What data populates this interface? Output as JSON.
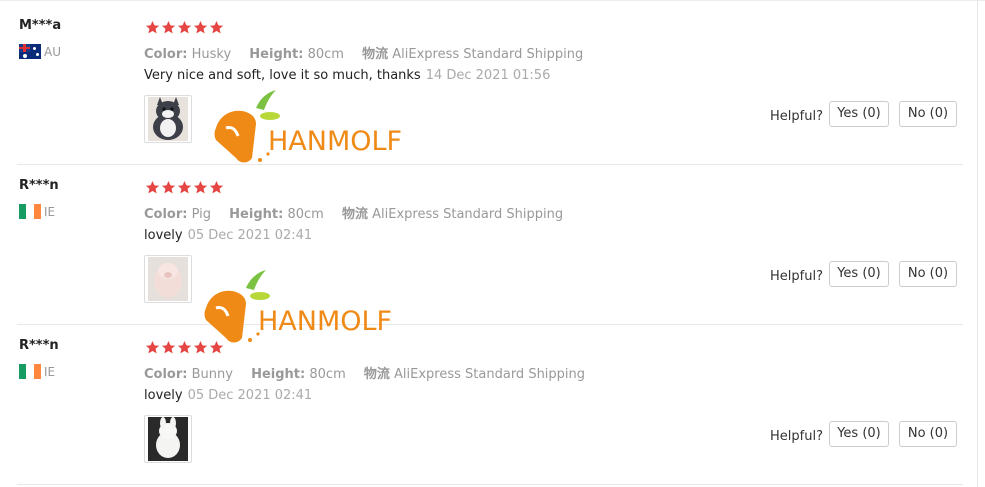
{
  "colors": {
    "star": "#e64545",
    "border": "#e8e8e8",
    "muted": "#999999",
    "watermark": "#f08a16"
  },
  "helpful_label": "Helpful?",
  "watermark_text": "HANMOLF",
  "reviews": [
    {
      "user": "M***a",
      "country": "AU",
      "flag": "australia-flag-icon",
      "rating": 5,
      "color_label": "Color:",
      "color": "Husky",
      "height_label": "Height:",
      "height": "80cm",
      "ship_label": "物流",
      "shipping": "AliExpress Standard Shipping",
      "text": "Very nice and soft, love it so much, thanks",
      "date": "14 Dec 2021 01:56",
      "yes": "Yes (0)",
      "no": "No (0)"
    },
    {
      "user": "R***n",
      "country": "IE",
      "flag": "ireland-flag-icon",
      "rating": 5,
      "color_label": "Color:",
      "color": "Pig",
      "height_label": "Height:",
      "height": "80cm",
      "ship_label": "物流",
      "shipping": "AliExpress Standard Shipping",
      "text": "lovely",
      "date": "05 Dec 2021 02:41",
      "yes": "Yes (0)",
      "no": "No (0)"
    },
    {
      "user": "R***n",
      "country": "IE",
      "flag": "ireland-flag-icon",
      "rating": 5,
      "color_label": "Color:",
      "color": "Bunny",
      "height_label": "Height:",
      "height": "80cm",
      "ship_label": "物流",
      "shipping": "AliExpress Standard Shipping",
      "text": "lovely",
      "date": "05 Dec 2021 02:41",
      "yes": "Yes (0)",
      "no": "No (0)"
    }
  ]
}
